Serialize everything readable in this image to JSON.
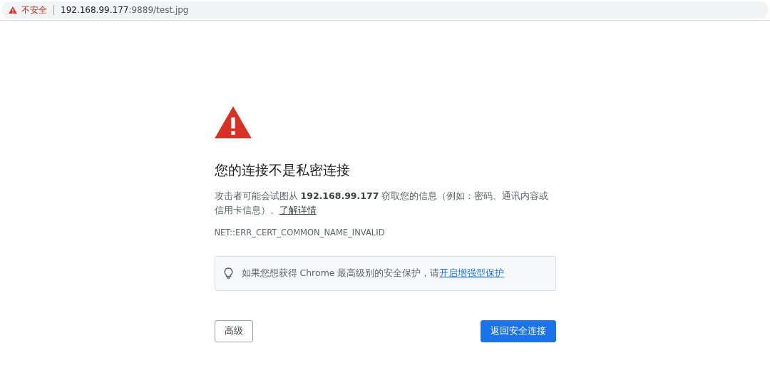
{
  "address_bar": {
    "security_label": "不安全",
    "host": "192.168.99.177",
    "path": ":9889/test.jpg"
  },
  "title": "您的连接不是私密连接",
  "message": {
    "text": "攻击者可能会试图从 **192.168.99.177** 窃取您的信息（例如：密码、通讯内容或信用卡信息）。",
    "link": "了解详情"
  },
  "error_code": "NET::ERR_CERT_COMMON_NAME_INVALID",
  "tip": {
    "text": "如果您想获得 Chrome 最高级别的安全保护，请",
    "link": "开启增强型保护"
  },
  "buttons": [
    {
      "kind": "secondary",
      "label": "高级"
    },
    {
      "kind": "primary",
      "label": "返回安全连接"
    }
  ]
}
